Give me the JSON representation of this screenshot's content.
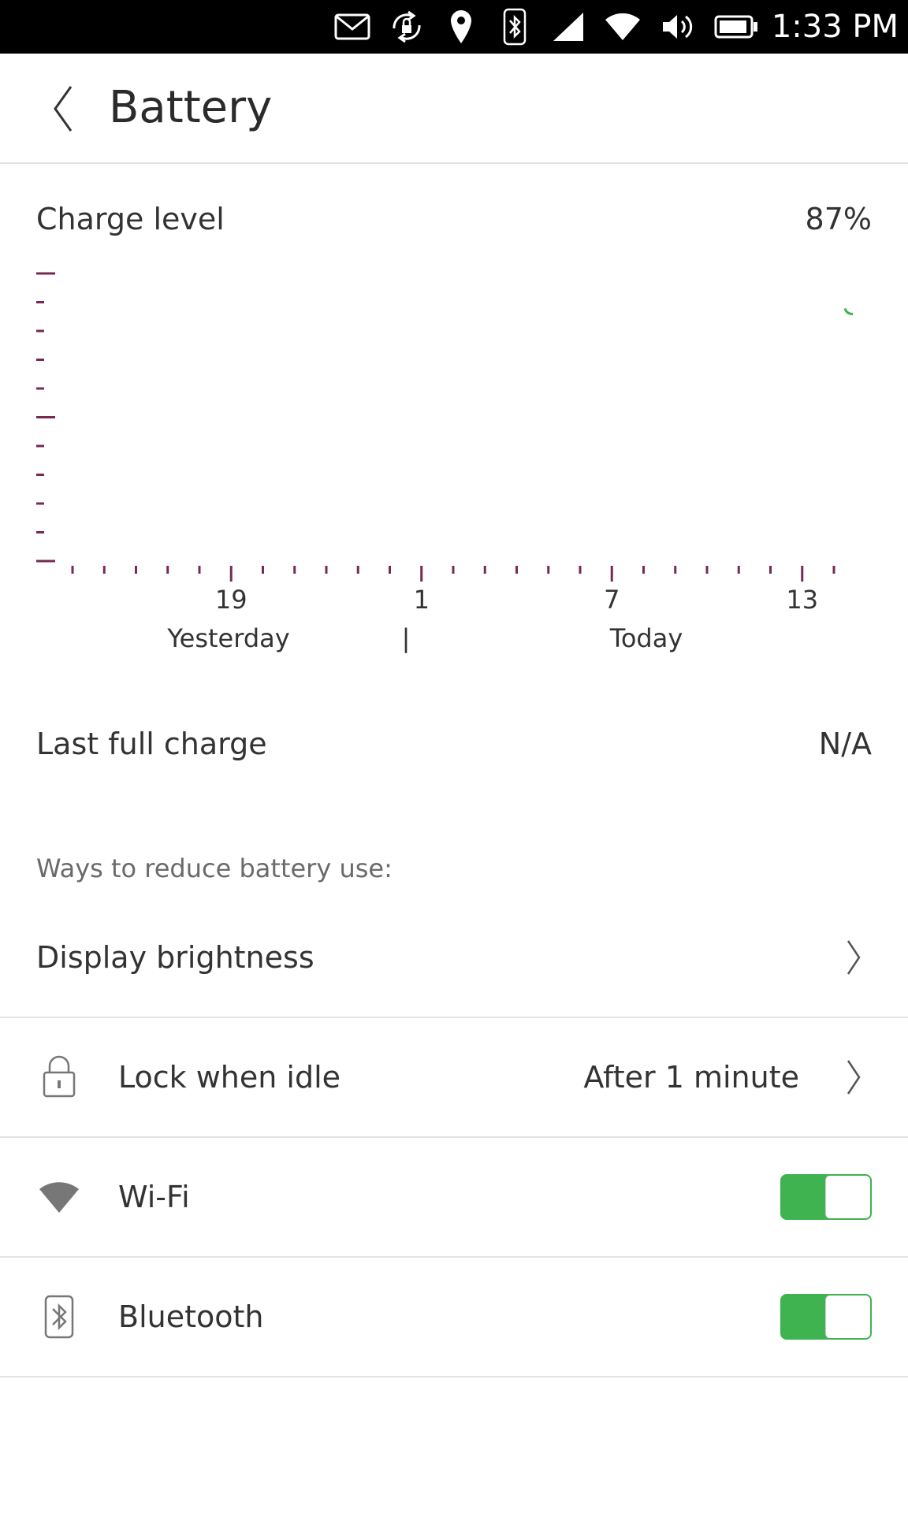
{
  "status_bar": {
    "time": "1:33 PM",
    "icons": [
      "mail-icon",
      "rotation-lock-icon",
      "location-icon",
      "bluetooth-icon",
      "signal-icon",
      "wifi-icon",
      "volume-icon",
      "battery-icon"
    ]
  },
  "header": {
    "title": "Battery",
    "back_icon": "chevron-left-icon"
  },
  "charge": {
    "label": "Charge level",
    "value": "87%"
  },
  "chart_data": {
    "type": "line",
    "x_tick_labels": [
      "19",
      "1",
      "7",
      "13"
    ],
    "day_labels": [
      "Yesterday",
      "Today"
    ],
    "day_separator": "|",
    "series": [
      {
        "values": [
          87
        ]
      }
    ],
    "ylim": [
      0,
      100
    ],
    "colors": {
      "axis": "#772953",
      "line": "#3eb34f"
    }
  },
  "last_full_charge": {
    "label": "Last full charge",
    "value": "N/A"
  },
  "reduce_section": {
    "heading": "Ways to reduce battery use:"
  },
  "settings": {
    "display_brightness": {
      "label": "Display brightness",
      "icon": "chevron-right-icon"
    },
    "lock_when_idle": {
      "label": "Lock when idle",
      "value": "After 1 minute",
      "icon": "lock-icon"
    },
    "wifi": {
      "label": "Wi-Fi",
      "enabled": true,
      "icon": "wifi-icon"
    },
    "bluetooth": {
      "label": "Bluetooth",
      "enabled": true,
      "icon": "bluetooth-icon"
    }
  },
  "colors": {
    "accent_green": "#3eb34f",
    "axis_purple": "#772953",
    "status_bar_bg": "#000000"
  }
}
